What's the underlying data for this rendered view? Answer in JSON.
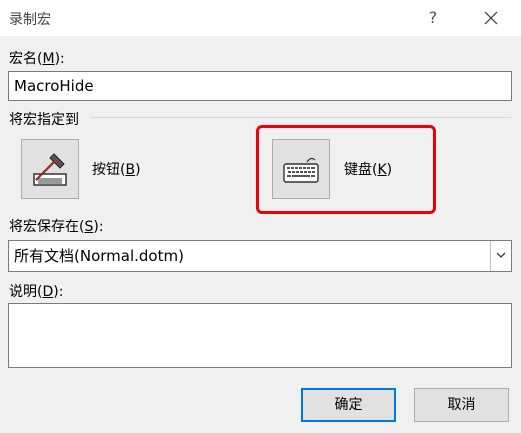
{
  "dialog": {
    "title": "录制宏",
    "help": "?"
  },
  "macro_name": {
    "label_prefix": "宏名(",
    "label_key": "M",
    "label_suffix": "):",
    "value": "MacroHide"
  },
  "assign": {
    "group_label": "将宏指定到",
    "button_label_prefix": "按钮(",
    "button_label_key": "B",
    "button_label_suffix": ")",
    "keyboard_label_prefix": "键盘(",
    "keyboard_label_key": "K",
    "keyboard_label_suffix": ")",
    "highlight_color": "#e8000b"
  },
  "store_in": {
    "label_prefix": "将宏保存在(",
    "label_key": "S",
    "label_suffix": "):",
    "selected": "所有文档(Normal.dotm)"
  },
  "description": {
    "label_prefix": "说明(",
    "label_key": "D",
    "label_suffix": "):",
    "value": ""
  },
  "buttons": {
    "ok": "确定",
    "cancel": "取消"
  },
  "colors": {
    "accent": "#0078d7",
    "dialog_bg": "#f0f0f0"
  },
  "icons": {
    "button_icon": "button-toolbar-icon",
    "keyboard_icon": "keyboard-icon"
  }
}
